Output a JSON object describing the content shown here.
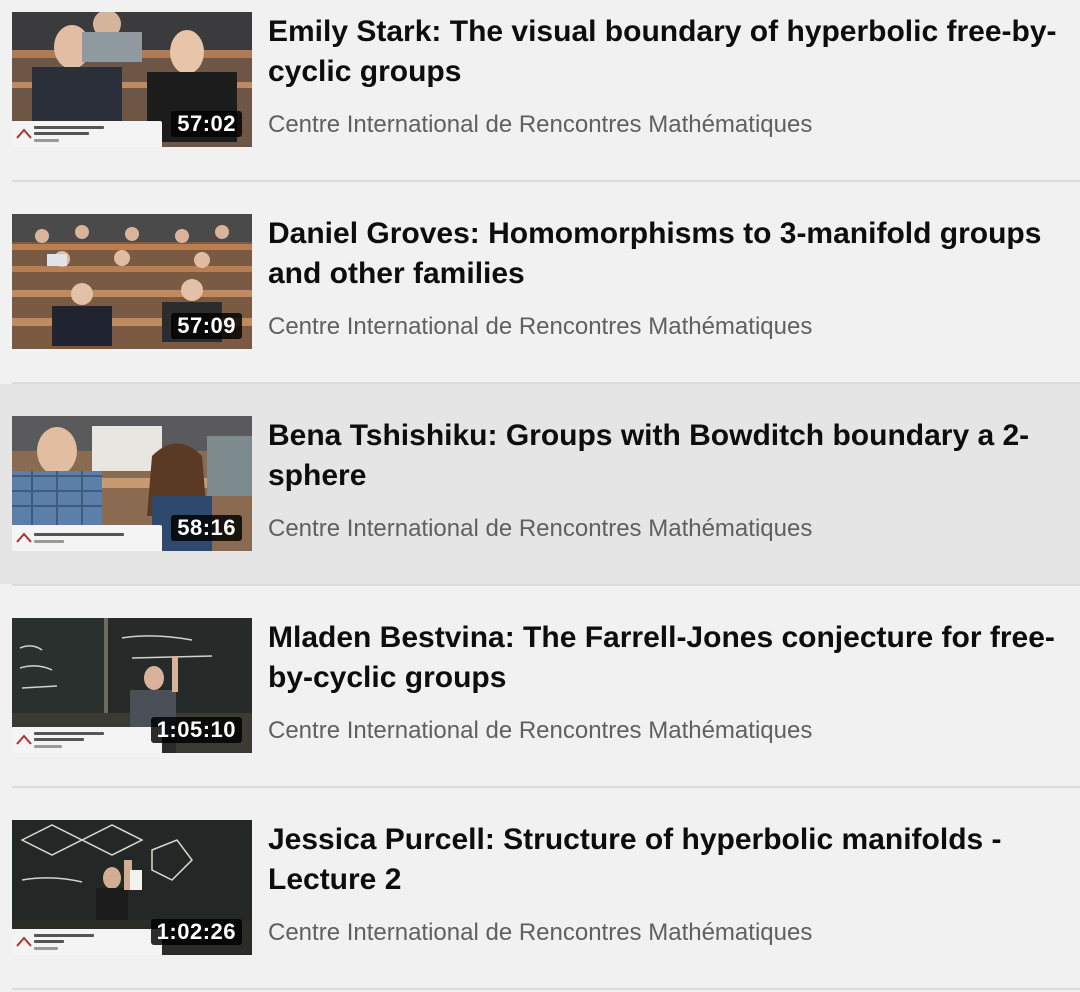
{
  "videos": [
    {
      "title": "Emily Stark: The visual boundary of hyperbolic free-by-cyclic groups",
      "duration": "57:02",
      "channel": "Centre International de Rencontres Mathématiques"
    },
    {
      "title": "Daniel Groves: Homomorphisms to 3-manifold groups and other families",
      "duration": "57:09",
      "channel": "Centre International de Rencontres Mathématiques"
    },
    {
      "title": "Bena Tshishiku: Groups with Bowditch boundary a 2-sphere",
      "duration": "58:16",
      "channel": "Centre International de Rencontres Mathématiques"
    },
    {
      "title": "Mladen Bestvina: The Farrell-Jones conjecture for free-by-cyclic groups",
      "duration": "1:05:10",
      "channel": "Centre International de Rencontres Mathématiques"
    },
    {
      "title": "Jessica Purcell: Structure of hyperbolic manifolds - Lecture 2",
      "duration": "1:02:26",
      "channel": "Centre International de Rencontres Mathématiques"
    }
  ],
  "colors": {
    "background": "#f1f1f1",
    "highlight": "#e5e5e5",
    "title": "#0d0d0d",
    "channel": "#606060"
  }
}
